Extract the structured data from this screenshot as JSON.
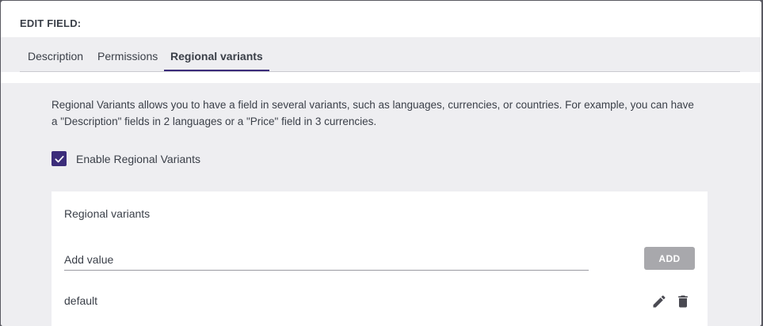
{
  "dialog": {
    "title": "EDIT FIELD:"
  },
  "tabs": [
    {
      "label": "Description",
      "active": false
    },
    {
      "label": "Permissions",
      "active": false
    },
    {
      "label": "Regional variants",
      "active": true
    }
  ],
  "panel": {
    "intro_text": "Regional Variants allows you to have a field in several variants, such as languages, currencies, or countries. For example, you can have a \"Description\" fields in 2 languages or a \"Price\" field in 3 currencies.",
    "enable_checkbox": {
      "label": "Enable Regional Variants",
      "checked": true
    }
  },
  "variants_card": {
    "title": "Regional variants",
    "input_placeholder": "Add value",
    "input_value": "",
    "add_button_label": "ADD",
    "items": [
      {
        "name": "default",
        "actions": [
          "pencil-icon",
          "trash-icon"
        ]
      }
    ]
  },
  "colors": {
    "accent": "#3b2c7a",
    "panel_background": "#eeeef1",
    "text": "#3a3f48",
    "disabled_button": "#a8a8ac"
  }
}
